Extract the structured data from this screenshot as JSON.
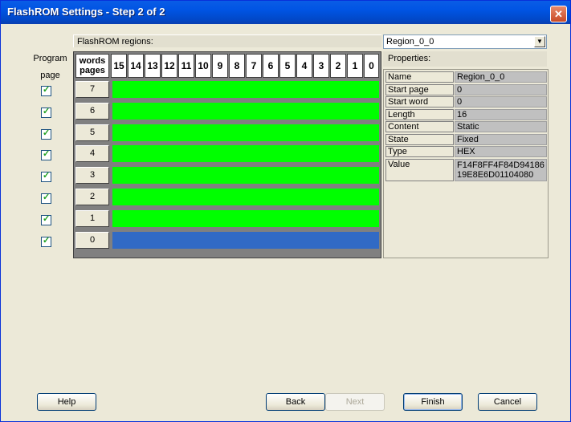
{
  "window": {
    "title": "FlashROM Settings - Step 2 of 2",
    "close_icon": "close-icon"
  },
  "left": {
    "program_label": "Program",
    "page_label": "page",
    "checkboxes": [
      true,
      true,
      true,
      true,
      true,
      true,
      true,
      true
    ]
  },
  "regions": {
    "label": "FlashROM regions:",
    "corner_top": "words",
    "corner_bottom": "pages",
    "word_columns": [
      "15",
      "14",
      "13",
      "12",
      "11",
      "10",
      "9",
      "8",
      "7",
      "6",
      "5",
      "4",
      "3",
      "2",
      "1",
      "0"
    ],
    "rows": [
      {
        "page": "7",
        "color": "#00ff00"
      },
      {
        "page": "6",
        "color": "#00ff00"
      },
      {
        "page": "5",
        "color": "#00ff00"
      },
      {
        "page": "4",
        "color": "#00ff00"
      },
      {
        "page": "3",
        "color": "#00ff00"
      },
      {
        "page": "2",
        "color": "#00ff00"
      },
      {
        "page": "1",
        "color": "#00ff00"
      },
      {
        "page": "0",
        "color": "#316ac5"
      }
    ]
  },
  "region_select": {
    "value": "Region_0_0"
  },
  "properties": {
    "label": "Properties:",
    "rows": [
      {
        "name": "Name",
        "value": "Region_0_0"
      },
      {
        "name": "Start page",
        "value": "0"
      },
      {
        "name": "Start word",
        "value": "0"
      },
      {
        "name": "Length",
        "value": "16"
      },
      {
        "name": "Content",
        "value": "Static"
      },
      {
        "name": "State",
        "value": "Fixed"
      },
      {
        "name": "Type",
        "value": "HEX"
      },
      {
        "name": "Value",
        "value": "F14F8FF4F84D9418619E8E6D01104080"
      }
    ]
  },
  "buttons": {
    "help": "Help",
    "back": "Back",
    "next": "Next",
    "finish": "Finish",
    "cancel": "Cancel"
  }
}
